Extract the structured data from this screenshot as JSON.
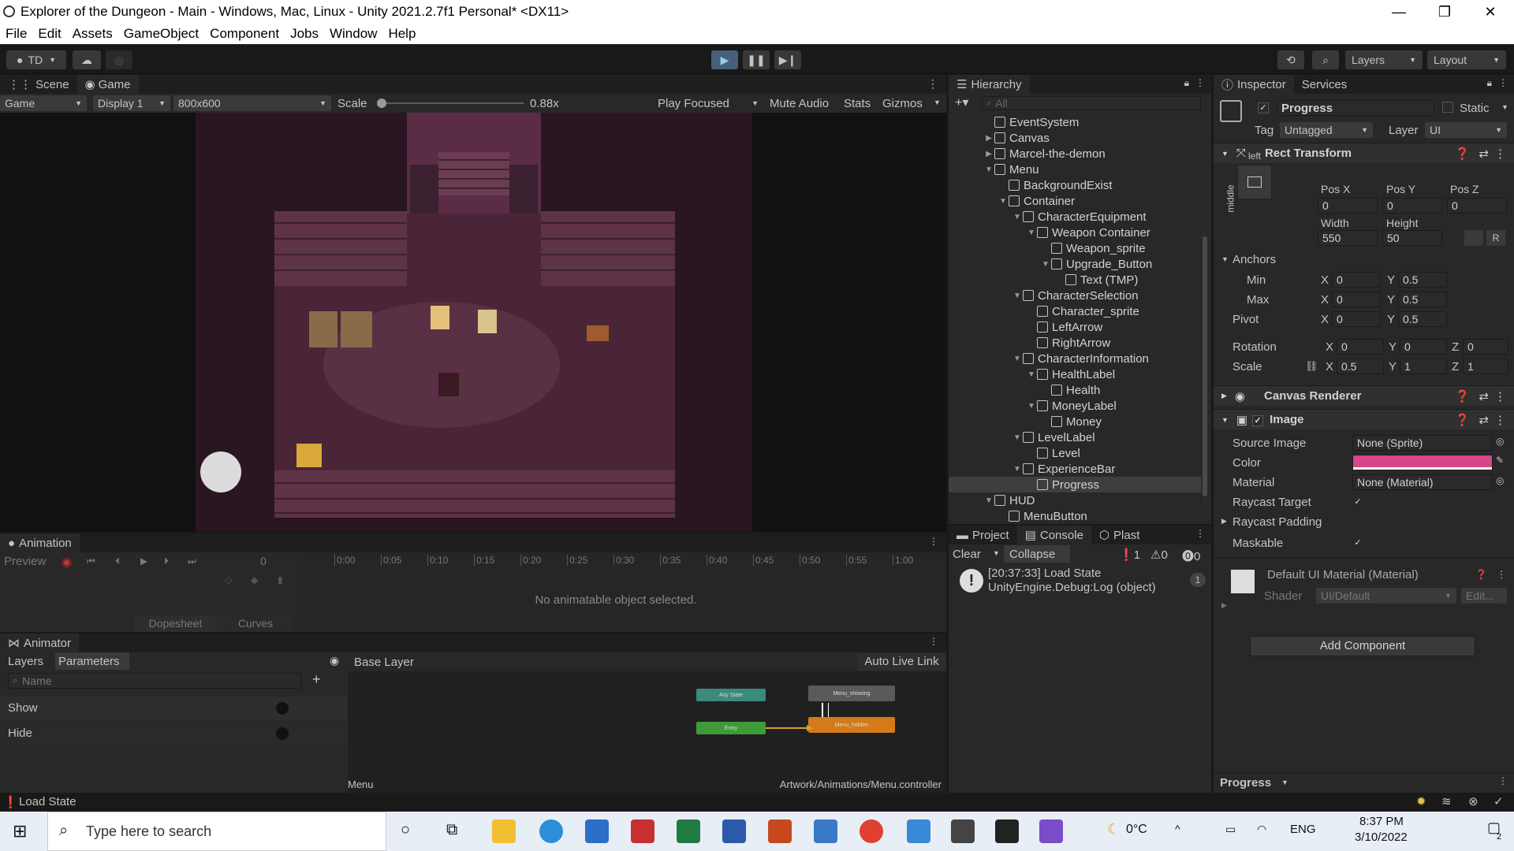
{
  "window": {
    "title": "Explorer of the Dungeon - Main - Windows, Mac, Linux - Unity 2021.2.7f1 Personal* <DX11>",
    "minimize": "—",
    "maximize": "❐",
    "close": "✕"
  },
  "menu": [
    "File",
    "Edit",
    "Assets",
    "GameObject",
    "Component",
    "Jobs",
    "Window",
    "Help"
  ],
  "toolbar": {
    "account": "TD",
    "layers": "Layers",
    "layout": "Layout"
  },
  "scene_tabs": {
    "scene": "Scene",
    "game": "Game"
  },
  "game_bar": {
    "mode": "Game",
    "display": "Display 1",
    "resolution": "800x600",
    "scale_label": "Scale",
    "scale_value": "0.88x",
    "scale_fraction": 0.02,
    "play_focused": "Play Focused",
    "mute_audio": "Mute Audio",
    "stats": "Stats",
    "gizmos": "Gizmos"
  },
  "animation": {
    "tab": "Animation",
    "preview": "Preview",
    "frame": "0",
    "ticks": [
      "0:00",
      "0:05",
      "0:10",
      "0:15",
      "0:20",
      "0:25",
      "0:30",
      "0:35",
      "0:40",
      "0:45",
      "0:50",
      "0:55",
      "1:00"
    ],
    "empty_message": "No animatable object selected.",
    "dopesheet": "Dopesheet",
    "curves": "Curves"
  },
  "animator": {
    "tab": "Animator",
    "layers": "Layers",
    "parameters": "Parameters",
    "search_placeholder": "Name",
    "params": [
      "Show",
      "Hide"
    ],
    "base_layer": "Base Layer",
    "auto_live_link": "Auto Live Link",
    "states": {
      "any": "Any State",
      "entry": "Entry",
      "showing": "Menu_showing",
      "hidden": "Menu_hidden"
    },
    "footer_left": "Menu",
    "footer_right": "Artwork/Animations/Menu.controller"
  },
  "hierarchy": {
    "tab": "Hierarchy",
    "search_placeholder": "All",
    "items": [
      {
        "label": "EventSystem",
        "depth": 0,
        "arrow": ""
      },
      {
        "label": "Canvas",
        "depth": 0,
        "arrow": "▶"
      },
      {
        "label": "Marcel-the-demon",
        "depth": 0,
        "arrow": "▶"
      },
      {
        "label": "Menu",
        "depth": 0,
        "arrow": "▼"
      },
      {
        "label": "BackgroundExist",
        "depth": 1,
        "arrow": ""
      },
      {
        "label": "Container",
        "depth": 1,
        "arrow": "▼"
      },
      {
        "label": "CharacterEquipment",
        "depth": 2,
        "arrow": "▼"
      },
      {
        "label": "Weapon Container",
        "depth": 3,
        "arrow": "▼"
      },
      {
        "label": "Weapon_sprite",
        "depth": 4,
        "arrow": ""
      },
      {
        "label": "Upgrade_Button",
        "depth": 4,
        "arrow": "▼"
      },
      {
        "label": "Text (TMP)",
        "depth": 5,
        "arrow": ""
      },
      {
        "label": "CharacterSelection",
        "depth": 2,
        "arrow": "▼"
      },
      {
        "label": "Character_sprite",
        "depth": 3,
        "arrow": ""
      },
      {
        "label": "LeftArrow",
        "depth": 3,
        "arrow": ""
      },
      {
        "label": "RightArrow",
        "depth": 3,
        "arrow": ""
      },
      {
        "label": "CharacterInformation",
        "depth": 2,
        "arrow": "▼"
      },
      {
        "label": "HealthLabel",
        "depth": 3,
        "arrow": "▼"
      },
      {
        "label": "Health",
        "depth": 4,
        "arrow": ""
      },
      {
        "label": "MoneyLabel",
        "depth": 3,
        "arrow": "▼"
      },
      {
        "label": "Money",
        "depth": 4,
        "arrow": ""
      },
      {
        "label": "LevelLabel",
        "depth": 2,
        "arrow": "▼"
      },
      {
        "label": "Level",
        "depth": 3,
        "arrow": ""
      },
      {
        "label": "ExperienceBar",
        "depth": 2,
        "arrow": "▼"
      },
      {
        "label": "Progress",
        "depth": 3,
        "arrow": "",
        "selected": true
      },
      {
        "label": "HUD",
        "depth": 0,
        "arrow": "▼"
      },
      {
        "label": "MenuButton",
        "depth": 1,
        "arrow": ""
      }
    ]
  },
  "console": {
    "tabs": [
      "Project",
      "Console",
      "Plast"
    ],
    "clear": "Clear",
    "collapse": "Collapse",
    "count_log": "1",
    "count_warn": "0",
    "count_err": "0",
    "entry_line1": "[20:37:33] Load State",
    "entry_line2": "UnityEngine.Debug:Log (object)",
    "entry_count": "1"
  },
  "inspector": {
    "tab": "Inspector",
    "services": "Services",
    "name": "Progress",
    "static": "Static",
    "tag_label": "Tag",
    "tag_value": "Untagged",
    "layer_label": "Layer",
    "layer_value": "UI",
    "rect_transform": "Rect Transform",
    "anchor_h": "left",
    "anchor_v": "middle",
    "pos_x_label": "Pos X",
    "pos_y_label": "Pos Y",
    "pos_z_label": "Pos Z",
    "pos_x": "0",
    "pos_y": "0",
    "pos_z": "0",
    "width_label": "Width",
    "height_label": "Height",
    "width": "550",
    "height": "50",
    "r_button": "R",
    "anchors": "Anchors",
    "min": "Min",
    "max": "Max",
    "pivot": "Pivot",
    "min_x": "0",
    "min_y": "0.5",
    "max_x": "0",
    "max_y": "0.5",
    "pivot_x": "0",
    "pivot_y": "0.5",
    "rotation": "Rotation",
    "scale": "Scale",
    "rot_x": "0",
    "rot_y": "0",
    "rot_z": "0",
    "scale_x": "0.5",
    "scale_y": "1",
    "scale_z": "1",
    "x": "X",
    "y": "Y",
    "z": "Z",
    "canvas_renderer": "Canvas Renderer",
    "image": "Image",
    "source_image_label": "Source Image",
    "source_image": "None (Sprite)",
    "color_label": "Color",
    "color_value": "#d6478a",
    "material_label": "Material",
    "material": "None (Material)",
    "raycast_target": "Raycast Target",
    "raycast_padding": "Raycast Padding",
    "maskable": "Maskable",
    "default_material": "Default UI Material (Material)",
    "shader_label": "Shader",
    "shader": "UI/Default",
    "edit": "Edit...",
    "add_component": "Add Component",
    "footer": "Progress"
  },
  "status": {
    "text": "Load State"
  },
  "taskbar": {
    "search_placeholder": "Type here to search",
    "weather": "0°C",
    "lang": "ENG",
    "time": "8:37 PM",
    "date": "3/10/2022",
    "notif": "2"
  }
}
